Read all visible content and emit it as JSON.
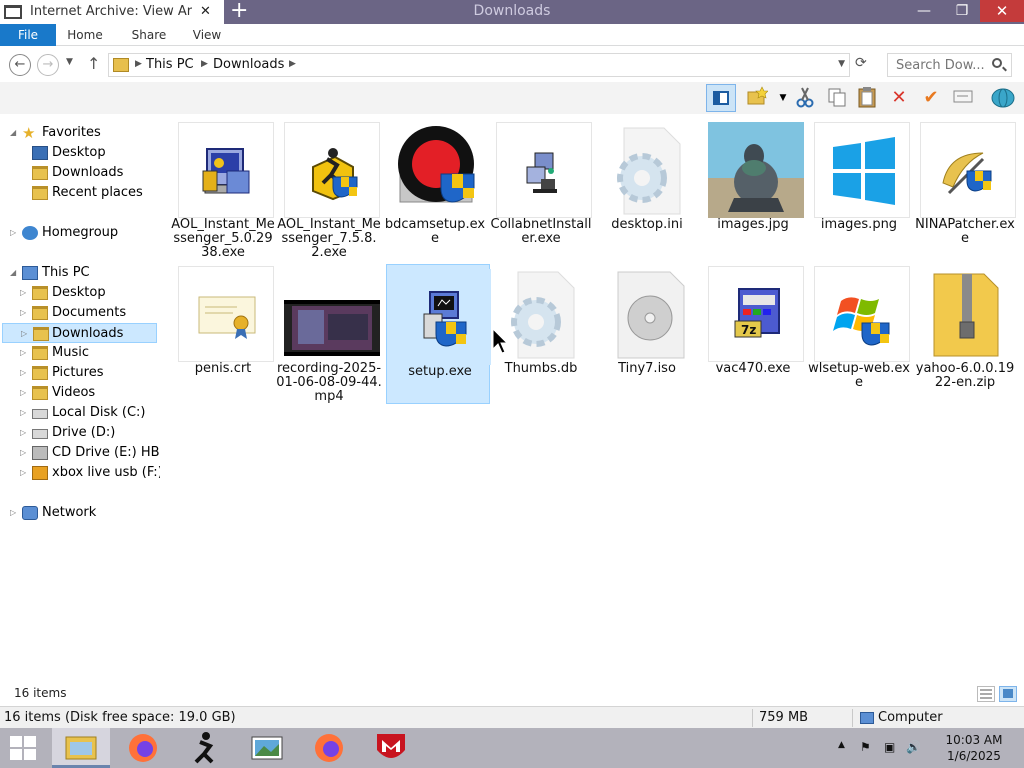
{
  "window": {
    "tab_title": "Internet Archive: View Arc",
    "title": "Downloads",
    "minimize": "—",
    "maximize": "❐",
    "close": "✕",
    "new_tab": "+"
  },
  "ribbon": {
    "file": "File",
    "home": "Home",
    "share": "Share",
    "view": "View"
  },
  "address": {
    "crumbs": [
      "This PC",
      "Downloads"
    ],
    "search_placeholder": "Search Dow..."
  },
  "nav": {
    "favorites": "Favorites",
    "fav_items": [
      "Desktop",
      "Downloads",
      "Recent places"
    ],
    "homegroup": "Homegroup",
    "this_pc": "This PC",
    "pc_items": [
      "Desktop",
      "Documents",
      "Downloads",
      "Music",
      "Pictures",
      "Videos",
      "Local Disk (C:)",
      "Drive (D:)",
      "CD Drive (E:) HBC",
      "xbox live usb (F:)"
    ],
    "network": "Network"
  },
  "files": [
    {
      "name": "AOL_Instant_Messenger_5.0.2938.exe",
      "icon": "aol-installer-icon"
    },
    {
      "name": "AOL_Instant_Messenger_7.5.8.2.exe",
      "icon": "aol-runner-shield-icon"
    },
    {
      "name": "bdcamsetup.exe",
      "icon": "bandicam-icon"
    },
    {
      "name": "CollabnetInstaller.exe",
      "icon": "computer-setup-icon"
    },
    {
      "name": "desktop.ini",
      "icon": "settings-file-icon"
    },
    {
      "name": "images.jpg",
      "icon": "pigeon-photo-icon"
    },
    {
      "name": "images.png",
      "icon": "windows-logo-icon"
    },
    {
      "name": "NINAPatcher.exe",
      "icon": "patcher-icon"
    },
    {
      "name": "penis.crt",
      "icon": "certificate-icon"
    },
    {
      "name": "recording-2025-01-06-08-09-44.mp4",
      "icon": "video-thumbnail-icon"
    },
    {
      "name": "setup.exe",
      "icon": "setup-shield-icon"
    },
    {
      "name": "Thumbs.db",
      "icon": "settings-file-icon"
    },
    {
      "name": "Tiny7.iso",
      "icon": "disc-image-icon"
    },
    {
      "name": "vac470.exe",
      "icon": "7zip-installer-icon"
    },
    {
      "name": "wlsetup-web.exe",
      "icon": "windows-flag-shield-icon"
    },
    {
      "name": "yahoo-6.0.0.1922-en.zip",
      "icon": "zip-folder-icon"
    }
  ],
  "status": {
    "item_count": "16 items",
    "details": "16 items (Disk free space: 19.0 GB)",
    "size": "759 MB",
    "location": "Computer"
  },
  "taskbar": {
    "time": "10:03 AM",
    "date": "1/6/2025"
  },
  "colors": {
    "accent": "#1979ca",
    "selection": "#cce8ff",
    "titlebar": "#6b6585",
    "taskbar": "#b3b2bb"
  }
}
